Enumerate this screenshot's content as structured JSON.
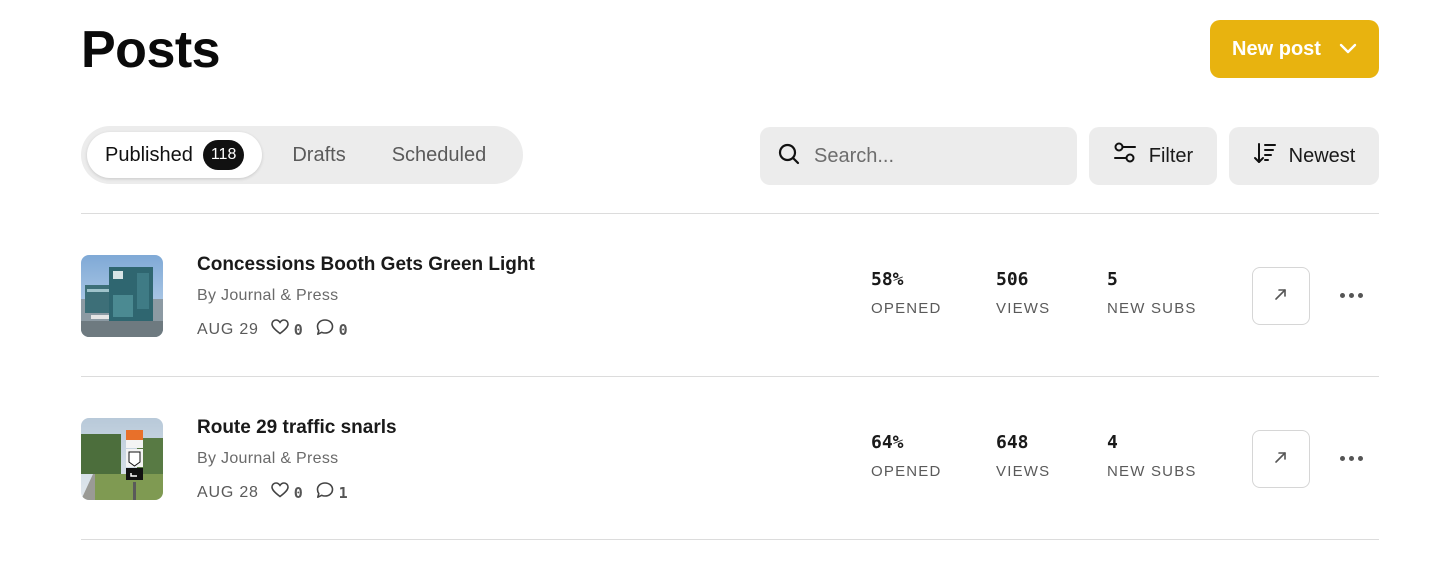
{
  "page": {
    "title": "Posts"
  },
  "actions": {
    "new_post_label": "New post"
  },
  "tabs": [
    {
      "label": "Published",
      "count": "118",
      "active": true
    },
    {
      "label": "Drafts",
      "active": false
    },
    {
      "label": "Scheduled",
      "active": false
    }
  ],
  "search": {
    "placeholder": "Search...",
    "value": ""
  },
  "filter": {
    "label": "Filter"
  },
  "sort": {
    "label": "Newest"
  },
  "posts": [
    {
      "title": "Concessions Booth Gets Green Light",
      "byline": "By Journal & Press",
      "date": "AUG 29",
      "likes": "0",
      "comments": "0",
      "opened": "58%",
      "opened_label": "OPENED",
      "views": "506",
      "views_label": "VIEWS",
      "new_subs": "5",
      "new_subs_label": "NEW SUBS",
      "thumbnail": "concessions-booth-photo"
    },
    {
      "title": "Route 29 traffic snarls",
      "byline": "By Journal & Press",
      "date": "AUG 28",
      "likes": "0",
      "comments": "1",
      "opened": "64%",
      "opened_label": "OPENED",
      "views": "648",
      "views_label": "VIEWS",
      "new_subs": "4",
      "new_subs_label": "NEW SUBS",
      "thumbnail": "route-29-sign-photo"
    }
  ],
  "colors": {
    "accent": "#e8b30f",
    "control_bg": "#ececec",
    "divider": "#dcdcdc",
    "badge_bg": "#111111"
  }
}
